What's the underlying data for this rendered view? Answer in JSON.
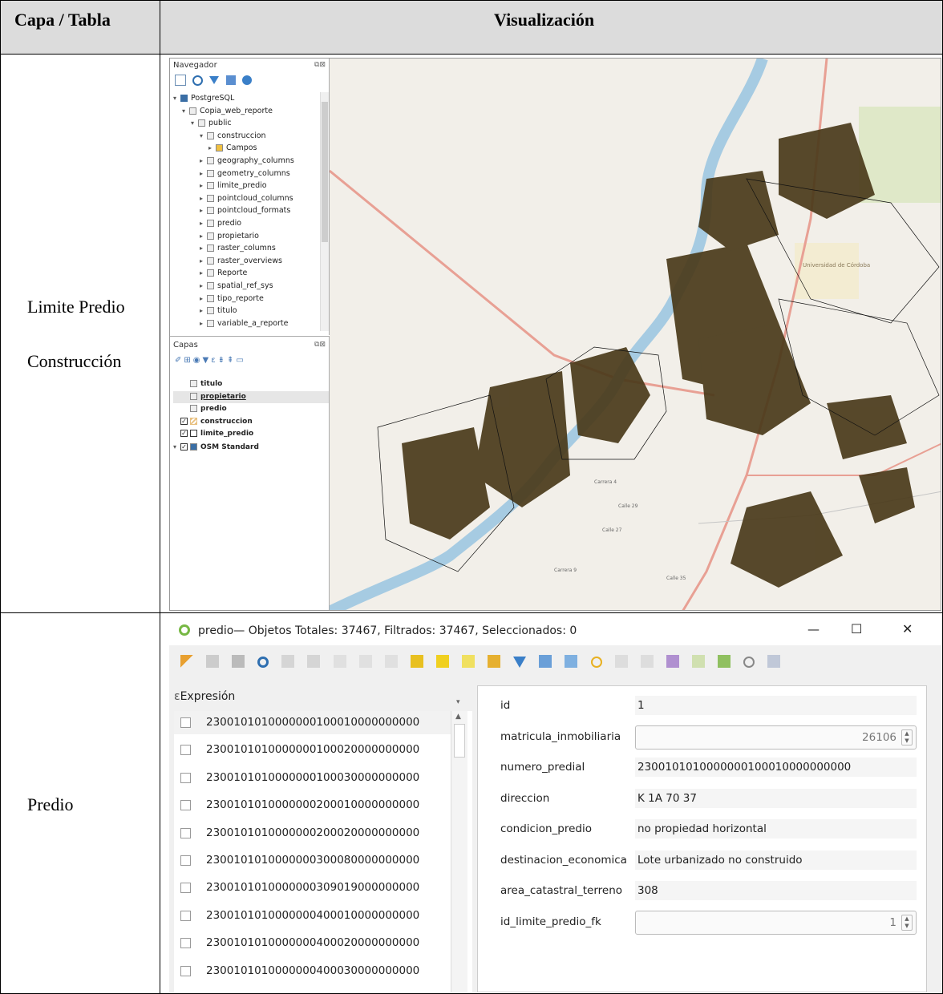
{
  "table": {
    "header_col1": "Capa / Tabla",
    "header_col2": "Visualización",
    "row1_label_a": "Limite Predio",
    "row1_label_b": "Construcción",
    "row2_label": "Predio"
  },
  "navigator": {
    "title": "Navegador",
    "items": [
      {
        "label": "PostgreSQL",
        "indent": 0,
        "arrow": "▾"
      },
      {
        "label": "Copia_web_reporte",
        "indent": 1,
        "arrow": "▾"
      },
      {
        "label": "public",
        "indent": 2,
        "arrow": "▾"
      },
      {
        "label": "construccion",
        "indent": 3,
        "arrow": "▾"
      },
      {
        "label": "Campos",
        "indent": 4,
        "arrow": "▸"
      },
      {
        "label": "geography_columns",
        "indent": 3,
        "arrow": "▸"
      },
      {
        "label": "geometry_columns",
        "indent": 3,
        "arrow": "▸"
      },
      {
        "label": "limite_predio",
        "indent": 3,
        "arrow": "▸"
      },
      {
        "label": "pointcloud_columns",
        "indent": 3,
        "arrow": "▸"
      },
      {
        "label": "pointcloud_formats",
        "indent": 3,
        "arrow": "▸"
      },
      {
        "label": "predio",
        "indent": 3,
        "arrow": "▸"
      },
      {
        "label": "propietario",
        "indent": 3,
        "arrow": "▸"
      },
      {
        "label": "raster_columns",
        "indent": 3,
        "arrow": "▸"
      },
      {
        "label": "raster_overviews",
        "indent": 3,
        "arrow": "▸"
      },
      {
        "label": "Reporte",
        "indent": 3,
        "arrow": "▸"
      },
      {
        "label": "spatial_ref_sys",
        "indent": 3,
        "arrow": "▸"
      },
      {
        "label": "tipo_reporte",
        "indent": 3,
        "arrow": "▸"
      },
      {
        "label": "titulo",
        "indent": 3,
        "arrow": "▸"
      },
      {
        "label": "variable_a_reporte",
        "indent": 3,
        "arrow": "▸"
      }
    ]
  },
  "layers": {
    "title": "Capas",
    "items": [
      {
        "label": "titulo",
        "check": "",
        "arrow": ""
      },
      {
        "label": "propietario",
        "check": "",
        "arrow": ""
      },
      {
        "label": "predio",
        "check": "",
        "arrow": ""
      },
      {
        "label": "construccion",
        "check": "✓",
        "arrow": ""
      },
      {
        "label": "limite_predio",
        "check": "✓",
        "arrow": ""
      },
      {
        "label": "OSM Standard",
        "check": "✓",
        "arrow": "▾"
      }
    ]
  },
  "map": {
    "labels": [
      "Universidad de Córdoba",
      "Calle 29",
      "Calle 27",
      "Carrera 9",
      "Carrera 4",
      "Calle 35"
    ]
  },
  "attr_window": {
    "title": "predio— Objetos Totales: 37467, Filtrados: 37467, Seleccionados: 0",
    "minimize": "—",
    "maximize": "☐",
    "close": "✕",
    "expression_label": "Expresión",
    "records": [
      "2300101010000000100010000000000",
      "2300101010000000100020000000000",
      "2300101010000000100030000000000",
      "2300101010000000200010000000000",
      "2300101010000000200020000000000",
      "2300101010000000300080000000000",
      "2300101010000000309019000000000",
      "2300101010000000400010000000000",
      "2300101010000000400020000000000",
      "2300101010000000400030000000000"
    ],
    "fields": [
      {
        "label": "id",
        "value": "1",
        "kind": "text"
      },
      {
        "label": "matricula_inmobiliaria",
        "value": "26106",
        "kind": "spin"
      },
      {
        "label": "numero_predial",
        "value": "2300101010000000100010000000000",
        "kind": "text"
      },
      {
        "label": "direccion",
        "value": "K 1A 70 37",
        "kind": "text"
      },
      {
        "label": "condicion_predio",
        "value": "no propiedad horizontal",
        "kind": "text"
      },
      {
        "label": "destinacion_economica",
        "value": "Lote urbanizado no construido",
        "kind": "text"
      },
      {
        "label": "area_catastral_terreno",
        "value": "308",
        "kind": "text"
      },
      {
        "label": "id_limite_predio_fk",
        "value": "1",
        "kind": "spin"
      }
    ]
  }
}
